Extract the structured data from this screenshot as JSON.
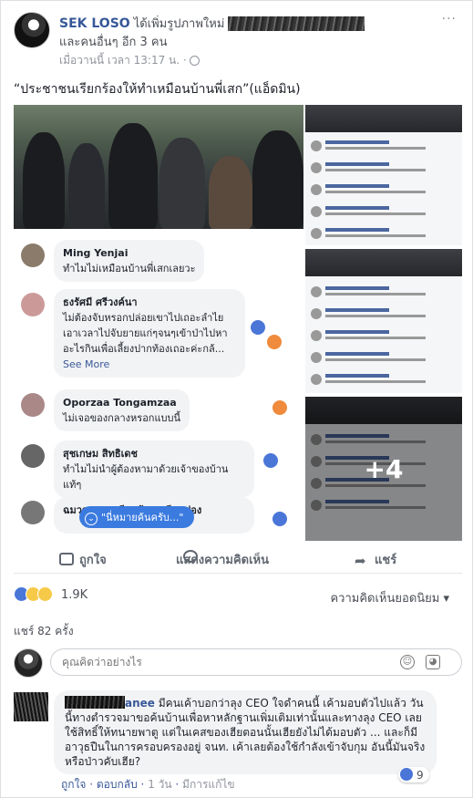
{
  "post": {
    "author": "SEK LOSO",
    "action": "ได้เพิ่มรูปภาพใหม่",
    "others": "และคนอื่นๆ อีก 3 คน",
    "timestamp": "เมื่อวานนี้ เวลา 13:17 น. ·",
    "privacy_icon": "globe-icon",
    "more_label": "···",
    "caption": "“ประชาชนเรียกร้องให้ทำเหมือนบ้านพี่เสก”(แอ็ดมิน)"
  },
  "photo": {
    "comments": [
      {
        "name": "Ming Yenjai",
        "text": "ทำไมไม่เหมือนบ้านพี่เสกเลยวะ"
      },
      {
        "name": "ธงรัศมี ศรีวงค์นา",
        "text": "ไม่ต้องจับหรอกปล่อยเขาไปเถอะลำไย เอาเวลาไปจับยายแก่ๆจนๆเข้าป่าไปหา อะไรกินเพื่อเลี้ยงปากท้องเถอะค่ะกล้...",
        "see_more": "See More"
      },
      {
        "name": "Oporzaa Tongamzaa",
        "text": "ไม่เจอของกลางหรอกแบบนี้"
      },
      {
        "name": "สุชเกษม สิทธิเดช",
        "text": "ทำไมไม่นำผู้ต้องหามาด้วยเจ้าของบ้านแท้ๆ"
      },
      {
        "name": "ฉมวกทอง เกลียดบ้านเกลียดช่อง",
        "text": ""
      }
    ],
    "pill_label": "\"นี่หมายค้นครับ...\"",
    "more_count": "+4"
  },
  "actions": {
    "like": "ถูกใจ",
    "comment": "แสดงความคิดเห็น",
    "share": "แชร์"
  },
  "stats": {
    "reaction_count": "1.9K",
    "top_comments": "ความคิดเห็นยอดนิยม ▾",
    "shares": "แชร์ 82 ครั้ง"
  },
  "composer": {
    "placeholder": "คุณคิดว่าอย่างไร"
  },
  "comment": {
    "name": "anee",
    "text": "มีคนเค้าบอกว่าลุง CEO ใจดำคนนี้ เค้ามอบตัวไปแล้ว วันนี้ทางตำรวจมาขอค้นบ้านเพื่อหาหลักฐานเพิ่มเติมเท่านั้นและทางลุง CEO เลยใช้สิทธิ์ให้ทนายพาตู แต่ในเคสของเฮียตอนนั้นเฮียยังไม่ได้มอบตัว ... และก็มีอาวุธปืนในการครอบครองอยู่ จนท. เค้าเลยต้องใช้กำลังเข้าจับกุม อันนี้มันจริงหรือป่าวคับเฮีย?",
    "like_count": "9",
    "like_label": "ถูกใจ",
    "reply_label": "ตอบกลับ",
    "time": "1 วัน",
    "edited": "มีการแก้ไข"
  },
  "colors": {
    "link": "#365899",
    "like_blue": "#4a76d8",
    "background": "#e9ebee"
  }
}
